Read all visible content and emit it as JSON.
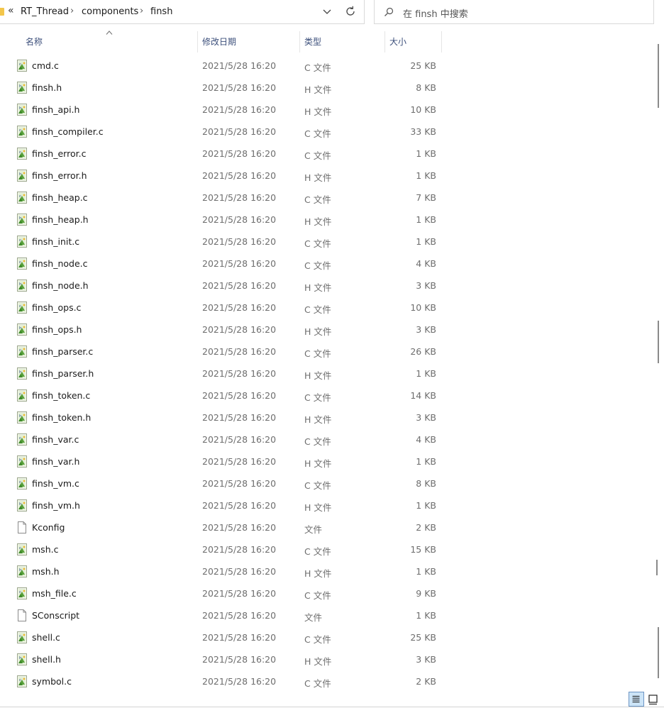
{
  "breadcrumb": {
    "overflow": "«",
    "items": [
      "RT_Thread",
      "components",
      "finsh"
    ],
    "separator": "›"
  },
  "search": {
    "placeholder": "在 finsh 中搜索"
  },
  "columns": {
    "name": "名称",
    "date": "修改日期",
    "type": "类型",
    "size": "大小"
  },
  "sort": {
    "column": "name",
    "direction": "ascending"
  },
  "files": [
    {
      "name": "cmd.c",
      "date": "2021/5/28 16:20",
      "type": "C 文件",
      "size": "25 KB",
      "icon": "c-source-icon"
    },
    {
      "name": "finsh.h",
      "date": "2021/5/28 16:20",
      "type": "H 文件",
      "size": "8 KB",
      "icon": "header-file-icon"
    },
    {
      "name": "finsh_api.h",
      "date": "2021/5/28 16:20",
      "type": "H 文件",
      "size": "10 KB",
      "icon": "header-file-icon"
    },
    {
      "name": "finsh_compiler.c",
      "date": "2021/5/28 16:20",
      "type": "C 文件",
      "size": "33 KB",
      "icon": "c-source-icon"
    },
    {
      "name": "finsh_error.c",
      "date": "2021/5/28 16:20",
      "type": "C 文件",
      "size": "1 KB",
      "icon": "c-source-icon"
    },
    {
      "name": "finsh_error.h",
      "date": "2021/5/28 16:20",
      "type": "H 文件",
      "size": "1 KB",
      "icon": "header-file-icon"
    },
    {
      "name": "finsh_heap.c",
      "date": "2021/5/28 16:20",
      "type": "C 文件",
      "size": "7 KB",
      "icon": "c-source-icon"
    },
    {
      "name": "finsh_heap.h",
      "date": "2021/5/28 16:20",
      "type": "H 文件",
      "size": "1 KB",
      "icon": "header-file-icon"
    },
    {
      "name": "finsh_init.c",
      "date": "2021/5/28 16:20",
      "type": "C 文件",
      "size": "1 KB",
      "icon": "c-source-icon"
    },
    {
      "name": "finsh_node.c",
      "date": "2021/5/28 16:20",
      "type": "C 文件",
      "size": "4 KB",
      "icon": "c-source-icon"
    },
    {
      "name": "finsh_node.h",
      "date": "2021/5/28 16:20",
      "type": "H 文件",
      "size": "3 KB",
      "icon": "header-file-icon"
    },
    {
      "name": "finsh_ops.c",
      "date": "2021/5/28 16:20",
      "type": "C 文件",
      "size": "10 KB",
      "icon": "c-source-icon"
    },
    {
      "name": "finsh_ops.h",
      "date": "2021/5/28 16:20",
      "type": "H 文件",
      "size": "3 KB",
      "icon": "header-file-icon"
    },
    {
      "name": "finsh_parser.c",
      "date": "2021/5/28 16:20",
      "type": "C 文件",
      "size": "26 KB",
      "icon": "c-source-icon"
    },
    {
      "name": "finsh_parser.h",
      "date": "2021/5/28 16:20",
      "type": "H 文件",
      "size": "1 KB",
      "icon": "header-file-icon"
    },
    {
      "name": "finsh_token.c",
      "date": "2021/5/28 16:20",
      "type": "C 文件",
      "size": "14 KB",
      "icon": "c-source-icon"
    },
    {
      "name": "finsh_token.h",
      "date": "2021/5/28 16:20",
      "type": "H 文件",
      "size": "3 KB",
      "icon": "header-file-icon"
    },
    {
      "name": "finsh_var.c",
      "date": "2021/5/28 16:20",
      "type": "C 文件",
      "size": "4 KB",
      "icon": "c-source-icon"
    },
    {
      "name": "finsh_var.h",
      "date": "2021/5/28 16:20",
      "type": "H 文件",
      "size": "1 KB",
      "icon": "header-file-icon"
    },
    {
      "name": "finsh_vm.c",
      "date": "2021/5/28 16:20",
      "type": "C 文件",
      "size": "8 KB",
      "icon": "c-source-icon"
    },
    {
      "name": "finsh_vm.h",
      "date": "2021/5/28 16:20",
      "type": "H 文件",
      "size": "1 KB",
      "icon": "header-file-icon"
    },
    {
      "name": "Kconfig",
      "date": "2021/5/28 16:20",
      "type": "文件",
      "size": "2 KB",
      "icon": "generic-file-icon"
    },
    {
      "name": "msh.c",
      "date": "2021/5/28 16:20",
      "type": "C 文件",
      "size": "15 KB",
      "icon": "c-source-icon"
    },
    {
      "name": "msh.h",
      "date": "2021/5/28 16:20",
      "type": "H 文件",
      "size": "1 KB",
      "icon": "header-file-icon"
    },
    {
      "name": "msh_file.c",
      "date": "2021/5/28 16:20",
      "type": "C 文件",
      "size": "9 KB",
      "icon": "c-source-icon"
    },
    {
      "name": "SConscript",
      "date": "2021/5/28 16:20",
      "type": "文件",
      "size": "1 KB",
      "icon": "generic-file-icon"
    },
    {
      "name": "shell.c",
      "date": "2021/5/28 16:20",
      "type": "C 文件",
      "size": "25 KB",
      "icon": "c-source-icon"
    },
    {
      "name": "shell.h",
      "date": "2021/5/28 16:20",
      "type": "H 文件",
      "size": "3 KB",
      "icon": "header-file-icon"
    },
    {
      "name": "symbol.c",
      "date": "2021/5/28 16:20",
      "type": "C 文件",
      "size": "2 KB",
      "icon": "c-source-icon"
    }
  ],
  "view": {
    "active": "details"
  },
  "colors": {
    "header_text": "#3c4f7b",
    "folder": "#f3c64b",
    "view_active_bg": "#cce4f7",
    "view_active_border": "#6d95c4"
  }
}
